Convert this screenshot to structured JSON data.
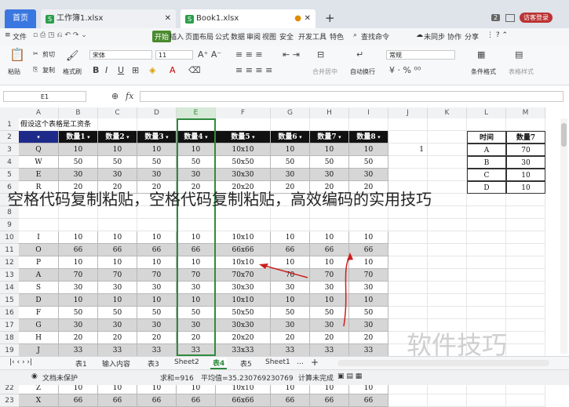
{
  "tabs": {
    "home": "首页",
    "file1": "工作簿1.xlsx",
    "file2": "Book1.xlsx",
    "count": "2",
    "guest": "访客登录"
  },
  "menu": {
    "file": "文件",
    "start": "开始",
    "items": [
      "插入",
      "页面布局",
      "公式",
      "数据",
      "审阅",
      "视图",
      "安全",
      "开发工具",
      "特色"
    ],
    "search": "查找命令",
    "unsync": "未同步",
    "collab": "协作",
    "share": "分享"
  },
  "ribbon": {
    "paste": "粘贴",
    "cut": "剪切",
    "copy": "复制",
    "format_painter": "格式刷",
    "font": "宋体",
    "size": "11",
    "merge": "合并居中",
    "wrap": "自动换行",
    "number_format": "常规",
    "cond_format": "条件格式",
    "table_style": "表格样式"
  },
  "formula_bar": {
    "cell_ref": "E1",
    "fx": "fx"
  },
  "columns": [
    "A",
    "B",
    "C",
    "D",
    "E",
    "F",
    "G",
    "H",
    "I",
    "J",
    "K",
    "L",
    "M"
  ],
  "rows": [
    "1",
    "2",
    "3",
    "4",
    "5",
    "6",
    "7",
    "8",
    "9",
    "10",
    "11",
    "12",
    "13",
    "14",
    "15",
    "16",
    "17",
    "18",
    "19",
    "20",
    "21",
    "22",
    "23"
  ],
  "title_cell": "假设这个表格是工资条",
  "headers": [
    "",
    "数量1",
    "数量2",
    "数量3",
    "数量4",
    "数量5",
    "数量6",
    "数量7",
    "数量8"
  ],
  "table": [
    [
      "Q",
      "10",
      "10",
      "10",
      "10",
      "10x10",
      "10",
      "10",
      "10"
    ],
    [
      "W",
      "50",
      "50",
      "50",
      "50",
      "50x50",
      "50",
      "50",
      "50"
    ],
    [
      "E",
      "30",
      "30",
      "30",
      "30",
      "30x30",
      "30",
      "30",
      "30"
    ],
    [
      "R",
      "20",
      "20",
      "20",
      "20",
      "20x20",
      "20",
      "20",
      "20"
    ],
    [
      "",
      "",
      "",
      "",
      "",
      "",
      "",
      "",
      ""
    ],
    [
      "",
      "",
      "",
      "",
      "",
      "",
      "",
      "",
      ""
    ],
    [
      "",
      "",
      "",
      "",
      "",
      "",
      "",
      "",
      ""
    ],
    [
      "I",
      "10",
      "10",
      "10",
      "10",
      "10x10",
      "10",
      "10",
      "10"
    ],
    [
      "O",
      "66",
      "66",
      "66",
      "66",
      "66x66",
      "66",
      "66",
      "66"
    ],
    [
      "P",
      "10",
      "10",
      "10",
      "10",
      "10x10",
      "10",
      "10",
      "10"
    ],
    [
      "A",
      "70",
      "70",
      "70",
      "70",
      "70x70",
      "70",
      "70",
      "70"
    ],
    [
      "S",
      "30",
      "30",
      "30",
      "30",
      "30x30",
      "30",
      "30",
      "30"
    ],
    [
      "D",
      "10",
      "10",
      "10",
      "10",
      "10x10",
      "10",
      "10",
      "10"
    ],
    [
      "F",
      "50",
      "50",
      "50",
      "50",
      "50x50",
      "50",
      "50",
      "50"
    ],
    [
      "G",
      "30",
      "30",
      "30",
      "30",
      "30x30",
      "30",
      "30",
      "30"
    ],
    [
      "H",
      "20",
      "20",
      "20",
      "20",
      "20x20",
      "20",
      "20",
      "20"
    ],
    [
      "J",
      "33",
      "33",
      "33",
      "33",
      "33x33",
      "33",
      "33",
      "33"
    ],
    [
      "K",
      "77",
      "77",
      "77",
      "77",
      "77x77",
      "77",
      "77",
      "77"
    ],
    [
      "L",
      "22",
      "22",
      "22",
      "22",
      "22x22",
      "22",
      "22",
      "22"
    ],
    [
      "Z",
      "10",
      "10",
      "10",
      "10",
      "10x10",
      "10",
      "10",
      "10"
    ],
    [
      "X",
      "66",
      "66",
      "66",
      "66",
      "66x66",
      "66",
      "66",
      "66"
    ]
  ],
  "j3": "1",
  "side_table": {
    "headers": [
      "时间",
      "数量7"
    ],
    "rows": [
      [
        "A",
        "70"
      ],
      [
        "B",
        "30"
      ],
      [
        "C",
        "10"
      ],
      [
        "D",
        "10"
      ]
    ]
  },
  "sheets": [
    "表1",
    "输入内容",
    "表3",
    "Sheet2",
    "表4",
    "表5",
    "Sheet1"
  ],
  "active_sheet": "表4",
  "status": {
    "doc": "文档未保护",
    "sum": "求和=916",
    "avg": "平均值=35.230769230769",
    "calc": "计算未完成"
  },
  "overlay_caption": "空格代码复制粘贴，空格代码复制粘贴，高效编码的实用技巧",
  "watermark": "软件技巧",
  "colors": {
    "accent": "#3a77e0",
    "header_fill": "#111111",
    "shade": "#d6d6d6",
    "selection": "#2e8b3e",
    "arrow": "#cc1f1f"
  }
}
